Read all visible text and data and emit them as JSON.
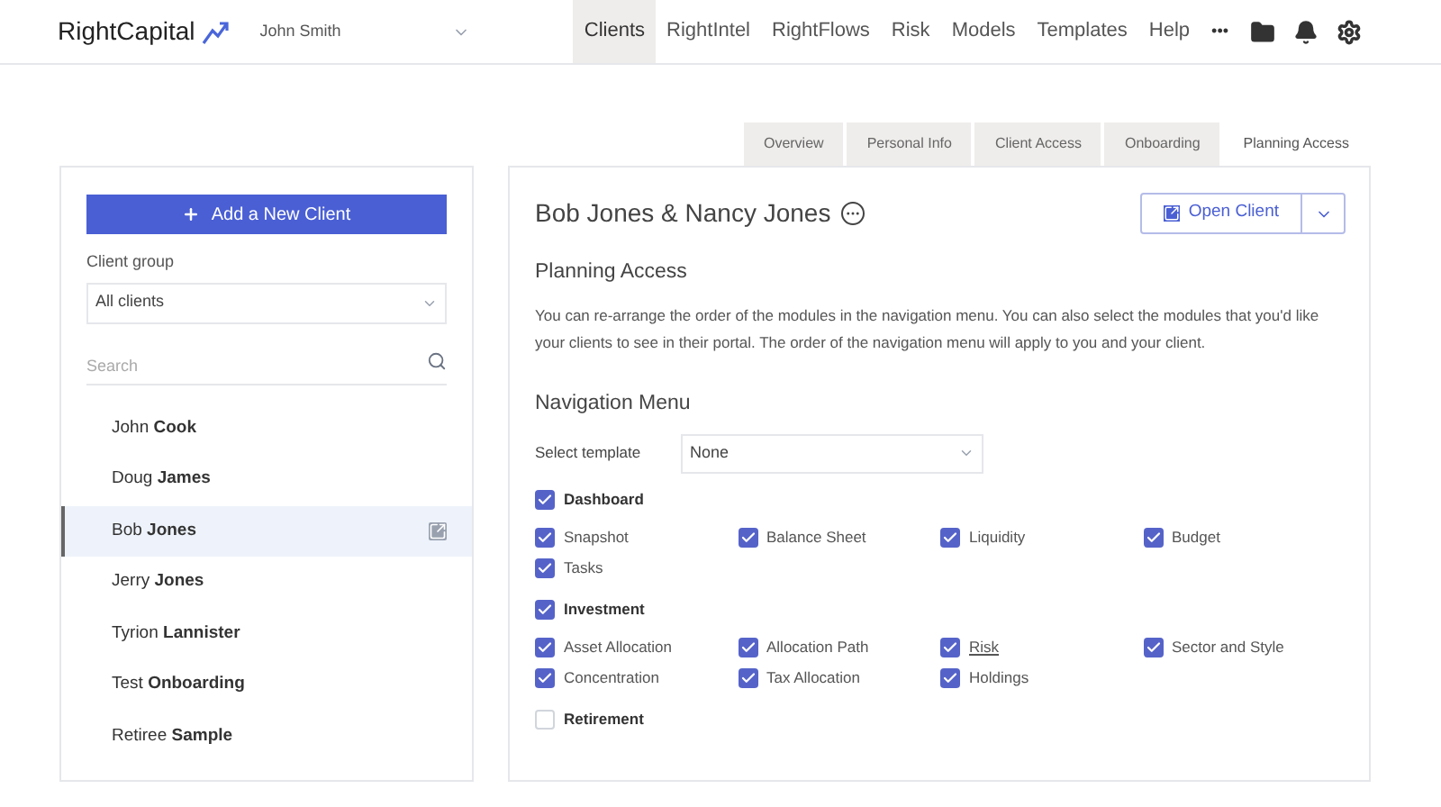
{
  "header": {
    "logo": "RightCapital",
    "user": "John Smith",
    "nav": [
      {
        "label": "Clients",
        "selected": true
      },
      {
        "label": "RightIntel",
        "selected": false
      },
      {
        "label": "RightFlows",
        "selected": false
      },
      {
        "label": "Risk",
        "selected": false
      },
      {
        "label": "Models",
        "selected": false
      },
      {
        "label": "Templates",
        "selected": false
      },
      {
        "label": "Help",
        "selected": false
      }
    ],
    "more": "•••"
  },
  "tabs": [
    {
      "label": "Overview",
      "selected": false
    },
    {
      "label": "Personal Info",
      "selected": false
    },
    {
      "label": "Client Access",
      "selected": false
    },
    {
      "label": "Onboarding",
      "selected": false
    },
    {
      "label": "Planning Access",
      "selected": true
    }
  ],
  "sidebar": {
    "add_button": "Add a New Client",
    "group_label": "Client group",
    "group_value": "All clients",
    "search": {
      "placeholder": "Search"
    },
    "clients": [
      {
        "name": "John **Cook**",
        "selected": false
      },
      {
        "name": "Doug **James**",
        "selected": false
      },
      {
        "name": "Bob **Jones**",
        "selected": true
      },
      {
        "name": "Jerry **Jones**",
        "selected": false
      },
      {
        "name": "Tyrion **Lannister**",
        "selected": false
      },
      {
        "name": "Test **Onboarding**",
        "selected": false
      },
      {
        "name": "Retiree **Sample**",
        "selected": false
      }
    ]
  },
  "main": {
    "client_name": "Bob Jones & Nancy Jones",
    "open_button": "Open Client",
    "section_title": "Planning Access",
    "description": "You can re-arrange the order of the modules in the navigation menu. You can also select the modules that you'd like your clients to see in their portal. The order of the navigation menu will apply to you and your client.",
    "nav_title": "Navigation Menu",
    "template_label": "Select template",
    "template_value": "None",
    "modules": [
      {
        "label": "Dashboard",
        "checked": true,
        "items": [
          {
            "label": "Snapshot",
            "checked": true,
            "underlined": false
          },
          {
            "label": "Balance Sheet",
            "checked": true,
            "underlined": false
          },
          {
            "label": "Liquidity",
            "checked": true,
            "underlined": false
          },
          {
            "label": "Budget",
            "checked": true,
            "underlined": false
          },
          {
            "label": "Tasks",
            "checked": true,
            "underlined": false
          }
        ]
      },
      {
        "label": "Investment",
        "checked": true,
        "items": [
          {
            "label": "Asset Allocation",
            "checked": true,
            "underlined": false
          },
          {
            "label": "Allocation Path",
            "checked": true,
            "underlined": false
          },
          {
            "label": "Risk",
            "checked": true,
            "underlined": true
          },
          {
            "label": "Sector and Style",
            "checked": true,
            "underlined": false
          },
          {
            "label": "Concentration",
            "checked": true,
            "underlined": false
          },
          {
            "label": "Tax Allocation",
            "checked": true,
            "underlined": false
          },
          {
            "label": "Holdings",
            "checked": true,
            "underlined": false
          }
        ]
      },
      {
        "label": "Retirement",
        "checked": false
      }
    ]
  }
}
